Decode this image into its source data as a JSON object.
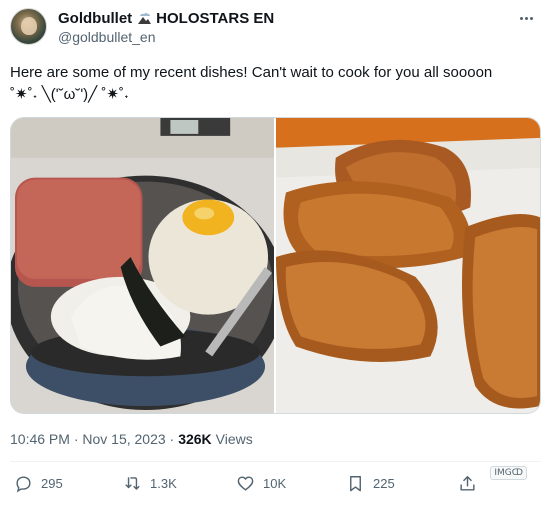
{
  "tweet": {
    "display_name": "Goldbullet",
    "display_name_suffix": "HOLOSTARS EN",
    "handle": "@goldbullet_en",
    "text": "Here are some of my recent dishes! Can't wait to cook for you all soooon\n˚✷˚˖ ╲(ʹ˘ω˘ʹ)╱ ˚✷˚˖",
    "timestamp": "10:46 PM · Nov 15, 2023 ·",
    "views_count": "326K",
    "views_label": "Views"
  },
  "actions": {
    "replies": "295",
    "reposts": "1.3K",
    "likes": "10K",
    "bookmarks": "225",
    "img_badge": "IMGↀ"
  },
  "icons": {
    "name_badge": "cloud-mountain-icon",
    "more": "more-icon",
    "reply": "reply-icon",
    "repost": "repost-icon",
    "like": "heart-icon",
    "bookmark": "bookmark-icon",
    "share": "share-icon"
  },
  "colors": {
    "text_primary": "#0f1419",
    "text_secondary": "#536471",
    "border": "#cfd9de"
  }
}
